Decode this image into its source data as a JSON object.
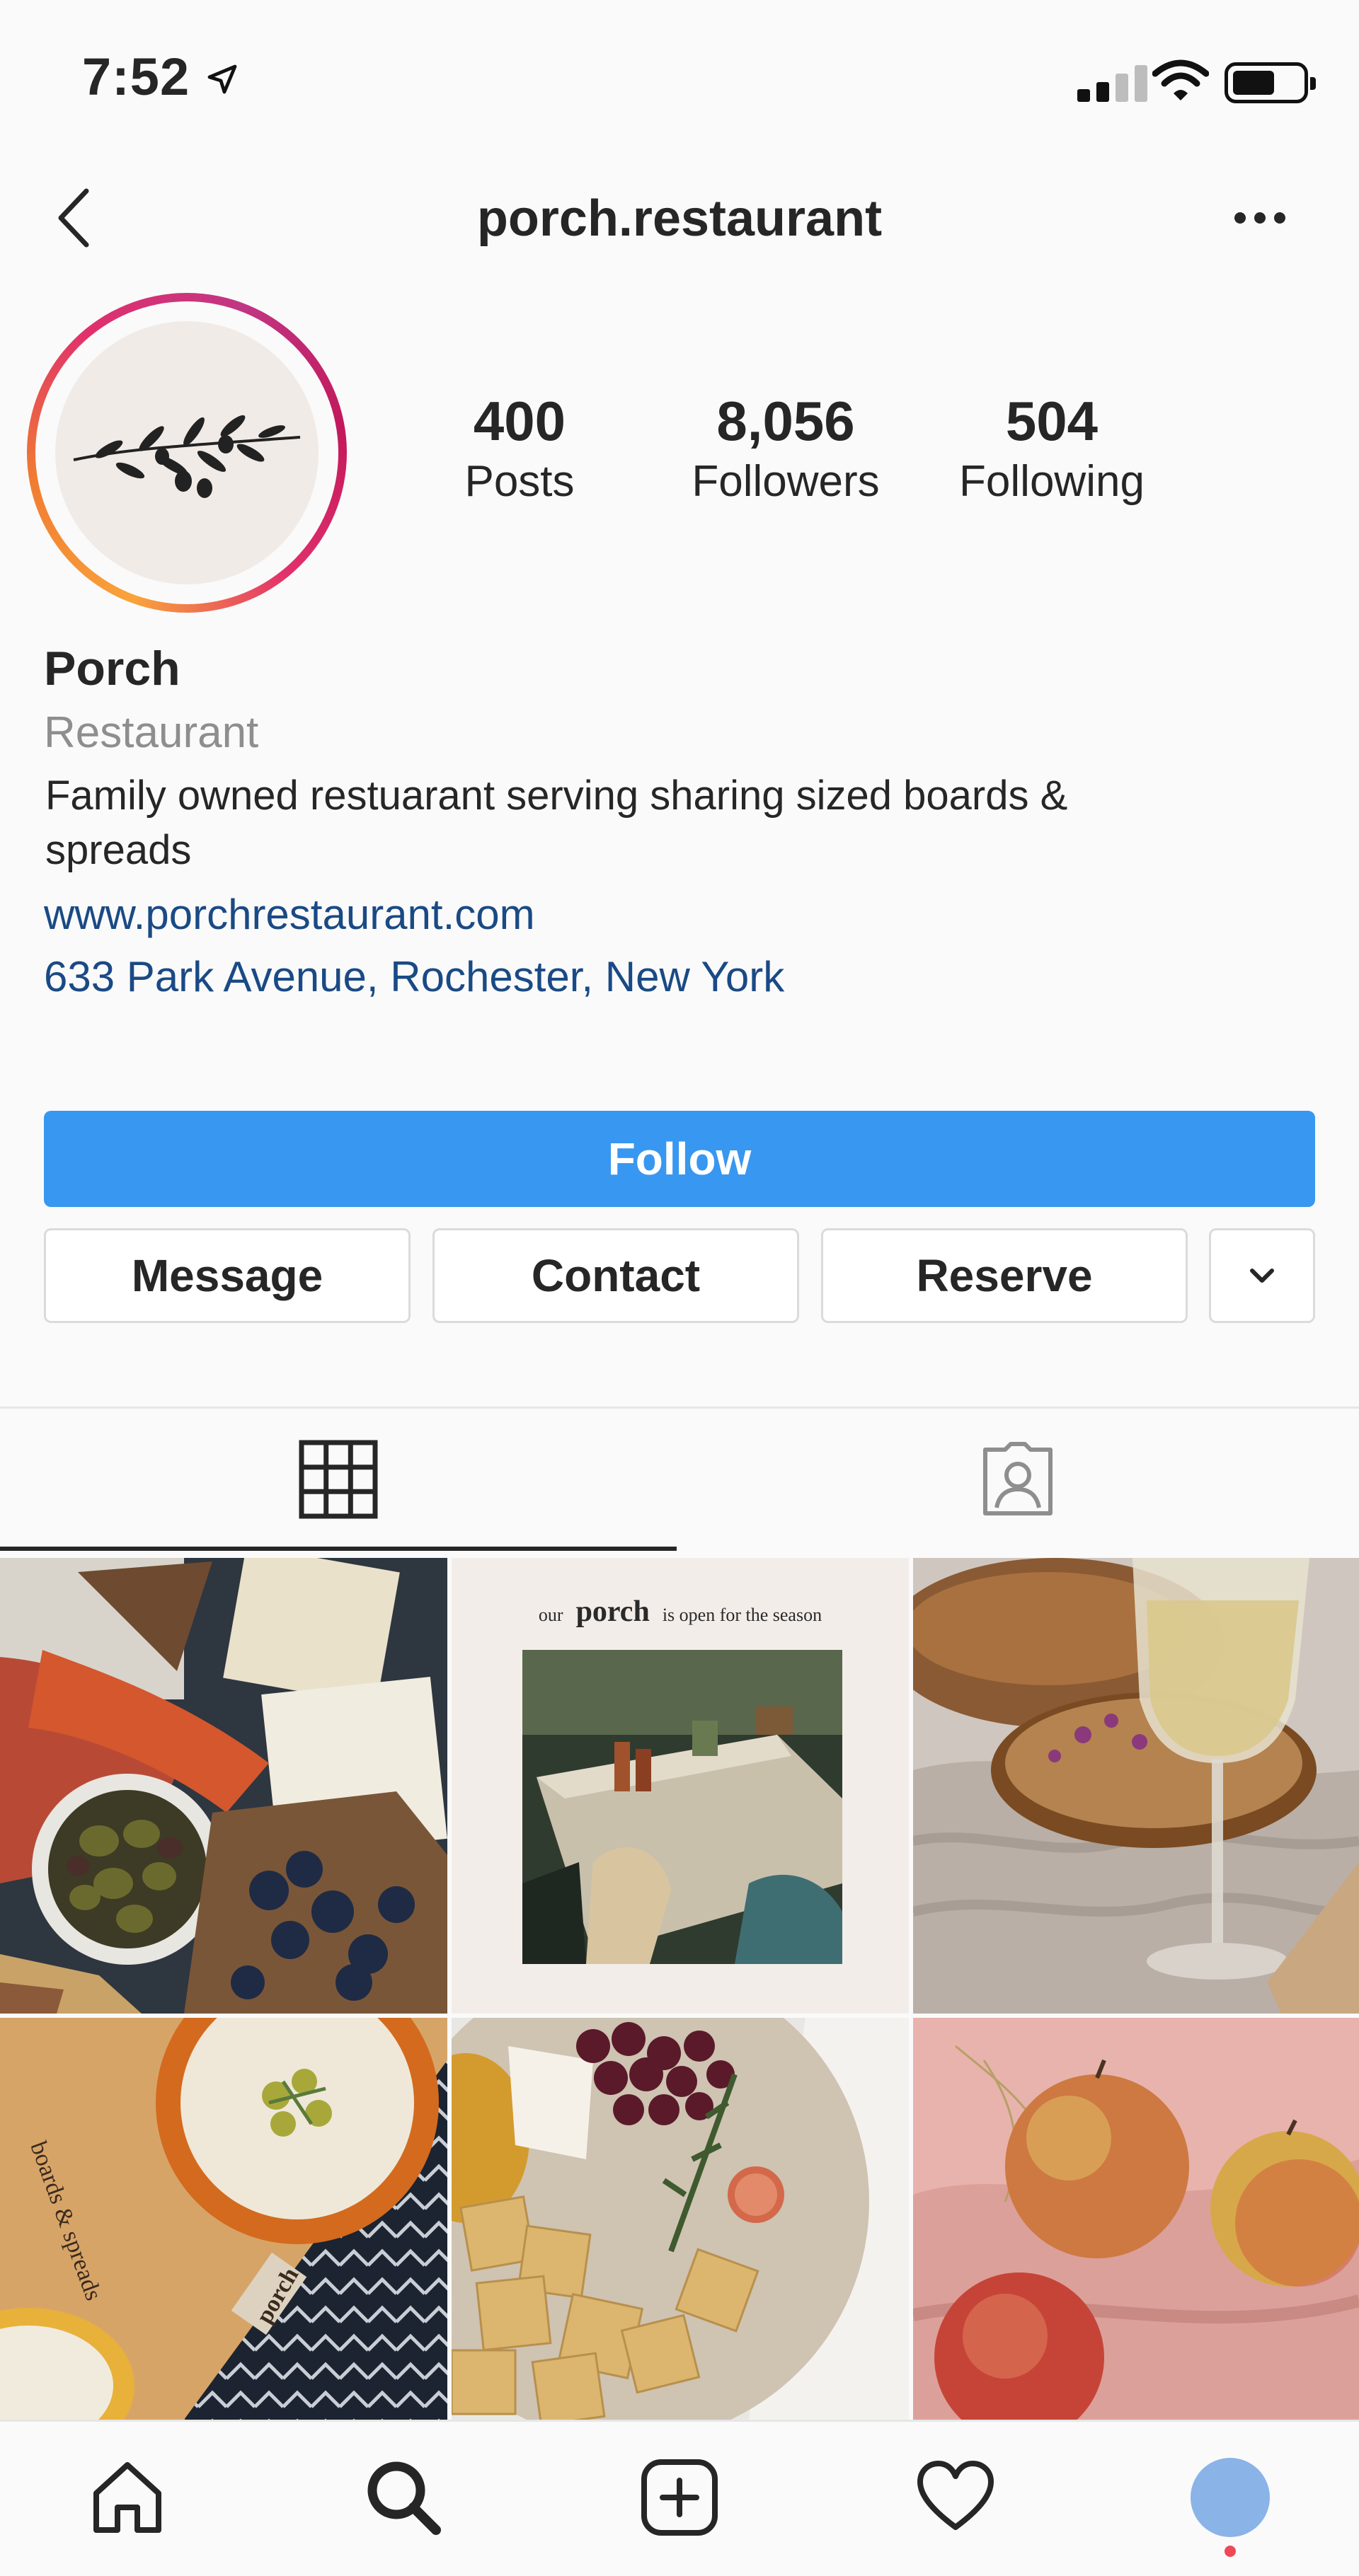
{
  "status_bar": {
    "time": "7:52"
  },
  "header": {
    "username": "porch.restaurant"
  },
  "profile": {
    "stats": [
      {
        "number": "400",
        "label": "Posts"
      },
      {
        "number": "8,056",
        "label": "Followers"
      },
      {
        "number": "504",
        "label": "Following"
      }
    ],
    "name": "Porch",
    "category": "Restaurant",
    "bio": "Family owned restuarant serving sharing sized boards & spreads",
    "website": "www.porchrestaurant.com",
    "address": "633 Park Avenue, Rochester, New York"
  },
  "actions": {
    "follow_label": "Follow",
    "message_label": "Message",
    "contact_label": "Contact",
    "reserve_label": "Reserve"
  },
  "tabs": [
    {
      "icon": "grid-icon",
      "selected": true
    },
    {
      "icon": "tagged-icon",
      "selected": false
    }
  ],
  "posts": {
    "post_2_caption": {
      "our": "our",
      "porch": "porch",
      "rest": "is open for the season"
    },
    "post_4_text": {
      "boards": "boards & spreads",
      "porch": "porch"
    }
  },
  "bottom_nav": [
    "home-icon",
    "search-icon",
    "new-post-icon",
    "activity-icon",
    "profile-avatar"
  ],
  "colors": {
    "follow": "#3897f0",
    "link": "#1a4a85",
    "accent_dot": "#ed4956"
  }
}
